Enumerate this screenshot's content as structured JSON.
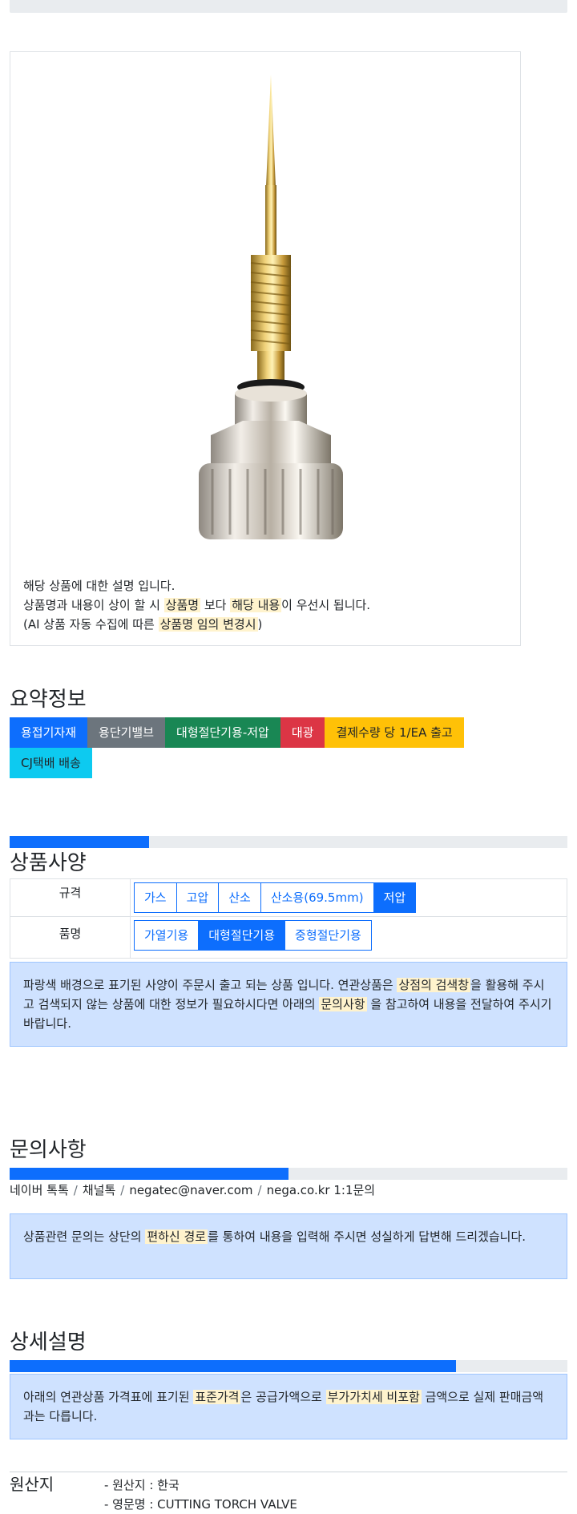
{
  "product": {
    "description": {
      "line1": "해당 상품에 대한 설명 입니다.",
      "line2_a": "상품명과 내용이 상이 할 시 ",
      "line2_hl1": "상품명",
      "line2_b": " 보다 ",
      "line2_hl2": "해당 내용",
      "line2_c": "이 우선시 됩니다.",
      "line3_a": "(AI 상품 자동 수집에 따른 ",
      "line3_hl": "상품명 임의 변경시",
      "line3_b": ")"
    }
  },
  "summary": {
    "title": "요약정보",
    "badges": [
      {
        "label": "용접기자재",
        "color": "#0d6efd"
      },
      {
        "label": "용단기밸브",
        "color": "#6c757d"
      },
      {
        "label": "대형절단기용-저압",
        "color": "#198754"
      },
      {
        "label": "대광",
        "color": "#dc3545"
      },
      {
        "label": "결제수량 당 1/EA 출고",
        "color": "#ffc107"
      },
      {
        "label": "CJ택배 배송",
        "color": "#0dcaf0"
      }
    ]
  },
  "spec": {
    "title": "상품사양",
    "progress": 0.25,
    "rows": [
      {
        "label": "규격",
        "options": [
          "가스",
          "고압",
          "산소",
          "산소용(69.5mm)",
          "저압"
        ],
        "active": "저압"
      },
      {
        "label": "품명",
        "options": [
          "가열기용",
          "대형절단기용",
          "중형절단기용"
        ],
        "active": "대형절단기용"
      }
    ],
    "notice": {
      "a": "파랑색 배경으로 표기된 사양이 주문시 출고 되는 상품 입니다. 연관상품은 ",
      "hl1": "상점의 검색창",
      "b": "을 활용해 주시고 검색되지 않는 상품에 대한 정보가 필요하시다면 아래의 ",
      "hl2": "문의사항",
      "c": " 을 참고하여 내용을 전달하여 주시기 바랍니다."
    }
  },
  "inquiry": {
    "title": "문의사항",
    "progress": 0.5,
    "contacts": [
      "네이버 톡톡",
      "채널톡",
      "negatec@naver.com",
      "nega.co.kr 1:1문의"
    ],
    "notice": {
      "a": "상품관련 문의는 상단의 ",
      "hl": "편하신 경로",
      "b": "를 통하여 내용을 입력해 주시면 성실하게 답변해 드리겠습니다."
    }
  },
  "detail": {
    "title": "상세설명",
    "progress": 0.8,
    "notice": {
      "a": "아래의 연관상품 가격표에 표기된 ",
      "hl1": "표준가격",
      "b": "은 공급가액으로 ",
      "hl2": "부가가치세 비포함",
      "c": " 금액으로 실제 판매금액과는 다릅니다."
    },
    "origin": {
      "label": "원산지",
      "lines": [
        "- 원산지 : 한국",
        "- 영문명 : CUTTING TORCH VALVE"
      ]
    }
  },
  "colors": {
    "primary": "#0d6efd",
    "highlight": "#fff3cd",
    "alert_bg": "#cfe2ff"
  }
}
